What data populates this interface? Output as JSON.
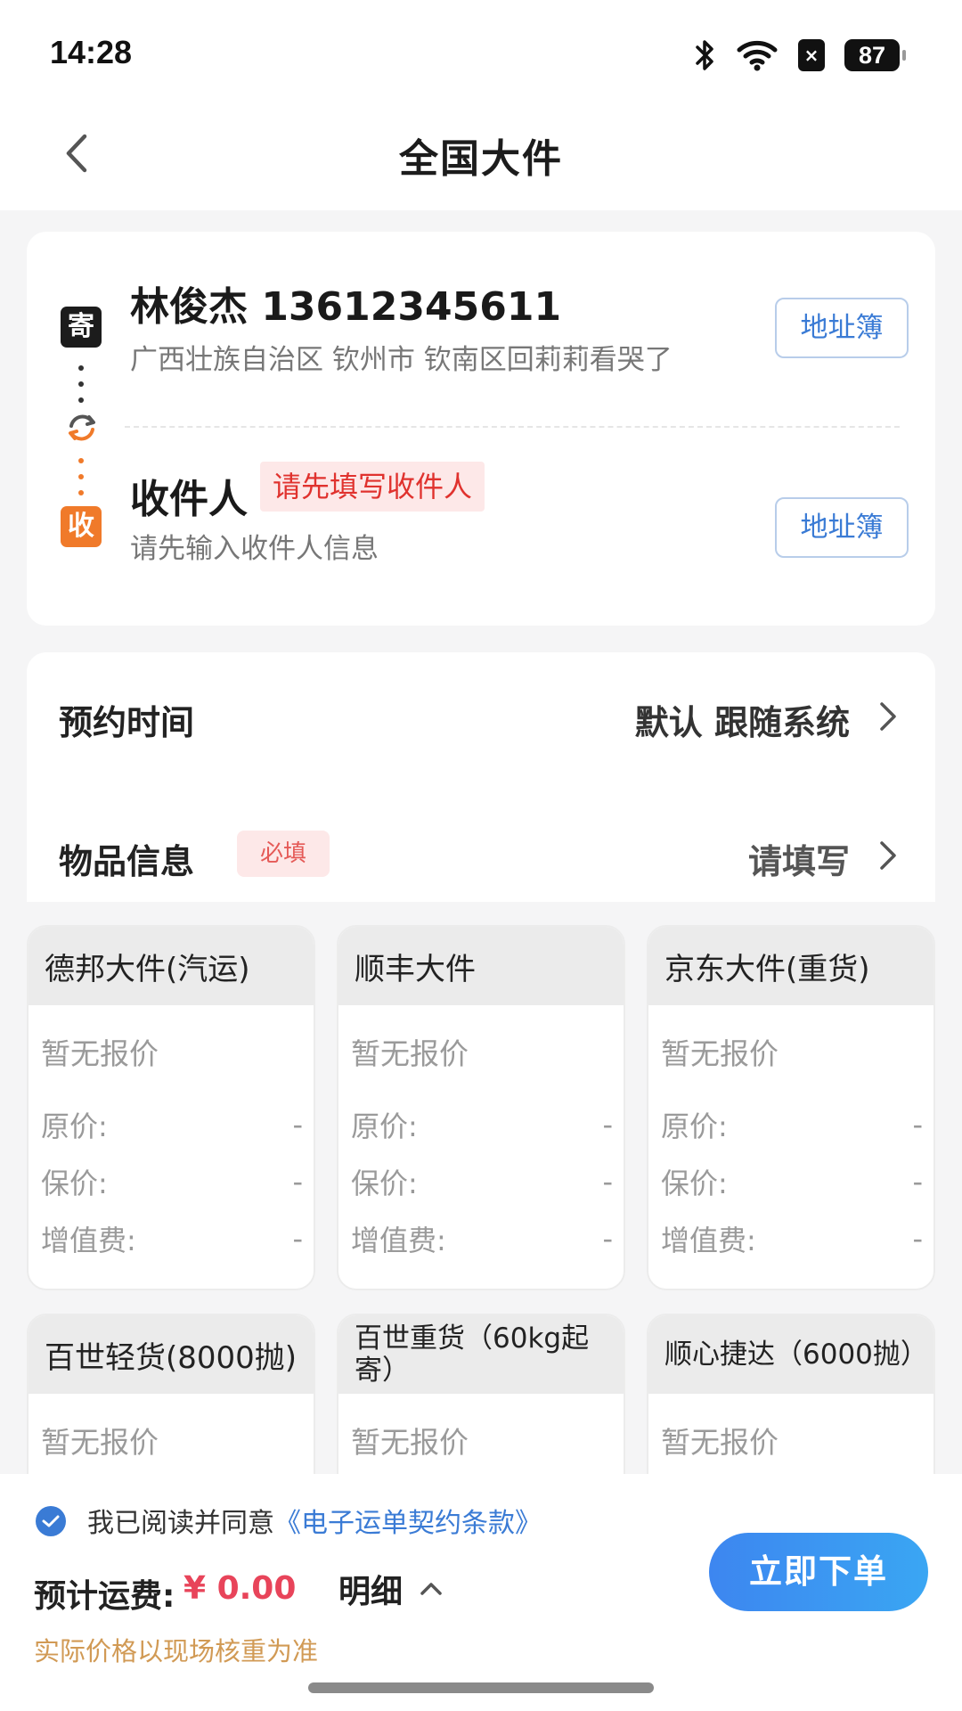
{
  "status_bar": {
    "time": "14:28",
    "battery": "87",
    "sim_label": "×"
  },
  "nav": {
    "title": "全国大件"
  },
  "sender": {
    "tag": "寄",
    "name_phone": "林俊杰 13612345611",
    "address": "广西壮族自治区 钦州市 钦南区回莉莉看哭了",
    "address_book_label": "地址簿"
  },
  "receiver": {
    "tag": "收",
    "title": "收件人",
    "warning": "请先填写收件人",
    "hint": "请先输入收件人信息",
    "address_book_label": "地址簿"
  },
  "schedule": {
    "label": "预约时间",
    "value": "默认 跟随系统"
  },
  "goods": {
    "label": "物品信息",
    "required_badge": "必填",
    "value": "请填写"
  },
  "carriers": [
    {
      "name": "德邦大件(汽运)",
      "quote": "暂无报价",
      "rows": [
        {
          "label": "原价:",
          "value": "-"
        },
        {
          "label": "保价:",
          "value": "-"
        },
        {
          "label": "增值费:",
          "value": "-"
        }
      ]
    },
    {
      "name": "顺丰大件",
      "quote": "暂无报价",
      "rows": [
        {
          "label": "原价:",
          "value": "-"
        },
        {
          "label": "保价:",
          "value": "-"
        },
        {
          "label": "增值费:",
          "value": "-"
        }
      ]
    },
    {
      "name": "京东大件(重货)",
      "quote": "暂无报价",
      "rows": [
        {
          "label": "原价:",
          "value": "-"
        },
        {
          "label": "保价:",
          "value": "-"
        },
        {
          "label": "增值费:",
          "value": "-"
        }
      ]
    },
    {
      "name": "百世轻货(8000抛)",
      "quote": "暂无报价"
    },
    {
      "name": "百世重货（60kg起寄）",
      "quote": "暂无报价"
    },
    {
      "name": "顺心捷达（6000抛）",
      "quote": "暂无报价"
    }
  ],
  "footer": {
    "agree_prefix": "我已阅读并同意",
    "agree_link": "《电子运单契约条款》",
    "fee_label": "预计运费:",
    "fee_value": "¥ 0.00",
    "detail_label": "明细",
    "order_button": "立即下单",
    "note": "实际价格以现场核重为准"
  },
  "colors": {
    "accent_blue": "#3a7bd5",
    "warning_red": "#e0322e",
    "price_red": "#e8445a",
    "note_orange": "#d19a55",
    "receiver_orange": "#f07a2a"
  }
}
